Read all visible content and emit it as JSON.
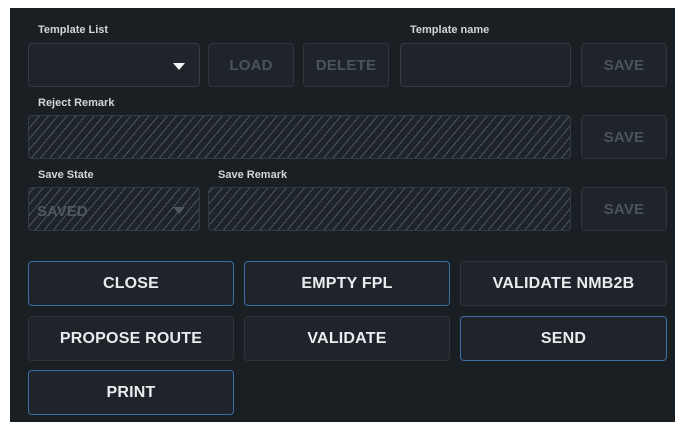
{
  "template": {
    "list_label": "Template List",
    "list_value": "",
    "load_label": "LOAD",
    "delete_label": "DELETE",
    "name_label": "Template name",
    "name_value": "",
    "save_label": "SAVE"
  },
  "reject": {
    "label": "Reject Remark",
    "save_label": "SAVE"
  },
  "save_state": {
    "label": "Save State",
    "value": "SAVED",
    "remark_label": "Save Remark",
    "save_label": "SAVE"
  },
  "actions": {
    "close": "CLOSE",
    "empty_fpl": "EMPTY FPL",
    "validate_nmb2b": "VALIDATE NMB2B",
    "propose_route": "PROPOSE ROUTE",
    "validate": "VALIDATE",
    "send": "SEND",
    "print": "PRINT"
  },
  "colors": {
    "panel_bg": "#1a1f24",
    "focus_border": "#3a6ea6",
    "disabled_text": "#4b535b"
  }
}
